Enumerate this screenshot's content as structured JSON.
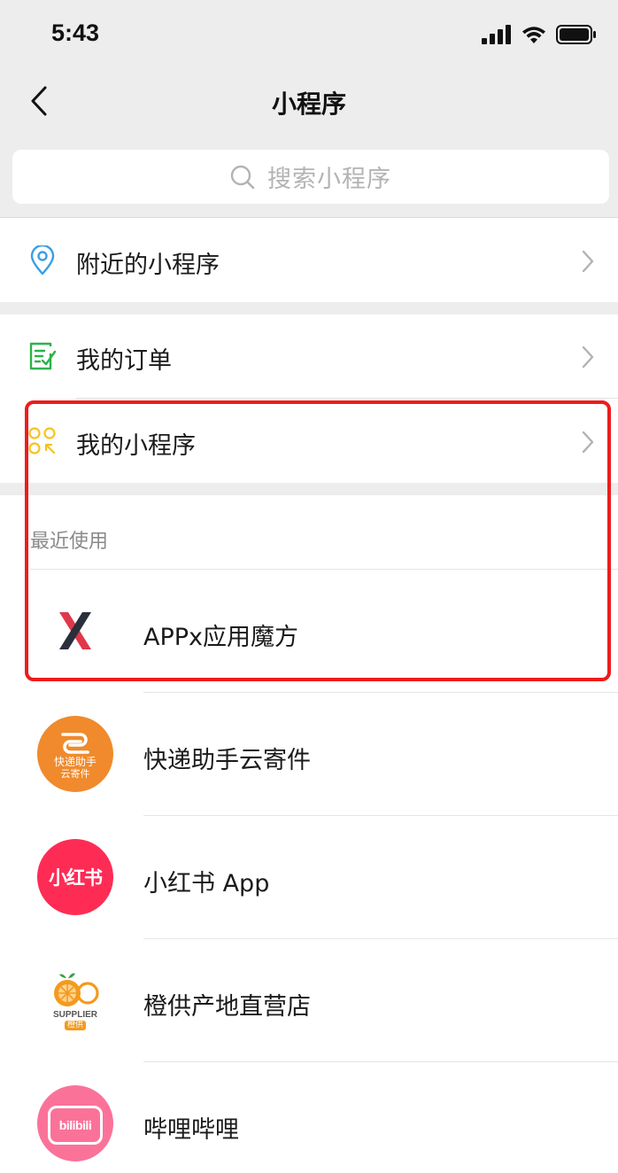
{
  "status": {
    "time": "5:43"
  },
  "nav": {
    "title": "小程序"
  },
  "search": {
    "placeholder": "搜索小程序"
  },
  "menu": {
    "nearby": "附近的小程序",
    "orders": "我的订单",
    "mine": "我的小程序"
  },
  "recent": {
    "title": "最近使用",
    "apps": [
      {
        "name": "APPx应用魔方",
        "logo_text": ""
      },
      {
        "name": "快递助手云寄件",
        "logo_text_1": "快递助手",
        "logo_text_2": "云寄件"
      },
      {
        "name": "小红书 App",
        "logo_text": "小红书"
      },
      {
        "name": "橙供产地直营店",
        "logo_text_1": "SUPPLIER",
        "logo_text_2": "橙供"
      },
      {
        "name": "哔哩哔哩",
        "logo_text": "bilibili"
      }
    ]
  },
  "colors": {
    "accent_blue": "#3a9ee8",
    "accent_green": "#2bb24c",
    "accent_yellow": "#f5c31c",
    "highlight_red": "#ee1c1c"
  }
}
